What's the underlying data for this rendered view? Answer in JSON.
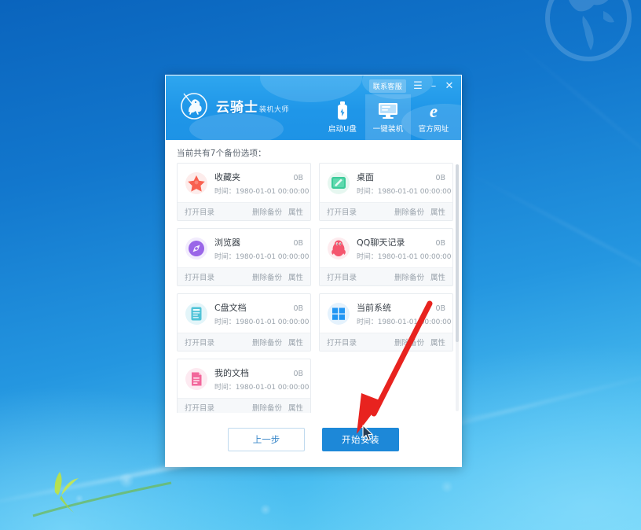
{
  "window": {
    "brand_name": "云骑士",
    "brand_sub": "装机大师",
    "support_label": "联系客服",
    "menu_icon": "hamburger-menu-icon",
    "minimize_icon": "minimize-icon",
    "close_icon": "close-icon",
    "menu_glyph": "☰",
    "minimize_glyph": "–",
    "close_glyph": "✕"
  },
  "nav": {
    "items": [
      {
        "label": "启动U盘",
        "icon": "usb-drive-icon",
        "active": false
      },
      {
        "label": "一键装机",
        "icon": "monitor-icon",
        "active": true
      },
      {
        "label": "官方网址",
        "icon": "internet-explorer-icon",
        "active": false
      }
    ]
  },
  "content": {
    "count_line": "当前共有7个备份选项：",
    "backup_count": 7,
    "cards": [
      {
        "title": "收藏夹",
        "size": "0B",
        "time": "时间：1980-01-01 00:00:00",
        "icon": "star-favorites-icon"
      },
      {
        "title": "桌面",
        "size": "0B",
        "time": "时间：1980-01-01 00:00:00",
        "icon": "desktop-icon"
      },
      {
        "title": "浏览器",
        "size": "0B",
        "time": "时间：1980-01-01 00:00:00",
        "icon": "browser-compass-icon"
      },
      {
        "title": "QQ聊天记录",
        "size": "0B",
        "time": "时间：1980-01-01 00:00:00",
        "icon": "qq-penguin-icon"
      },
      {
        "title": "C盘文档",
        "size": "0B",
        "time": "时间：1980-01-01 00:00:00",
        "icon": "c-drive-document-icon"
      },
      {
        "title": "当前系统",
        "size": "0B",
        "time": "时间：1980-01-01 00:00:00",
        "icon": "windows-logo-icon"
      },
      {
        "title": "我的文档",
        "size": "0B",
        "time": "时间：1980-01-01 00:00:00",
        "icon": "my-documents-icon"
      }
    ],
    "card_actions": {
      "open_dir": "打开目录",
      "delete_backup": "删除备份",
      "properties": "属性"
    }
  },
  "footer": {
    "prev_label": "上一步",
    "start_label": "开始安装"
  },
  "colors": {
    "header_blue": "#1e93e6",
    "primary_button": "#1d88d8",
    "annotation_red": "#e8231f",
    "desktop_blue": "#1277cd"
  }
}
